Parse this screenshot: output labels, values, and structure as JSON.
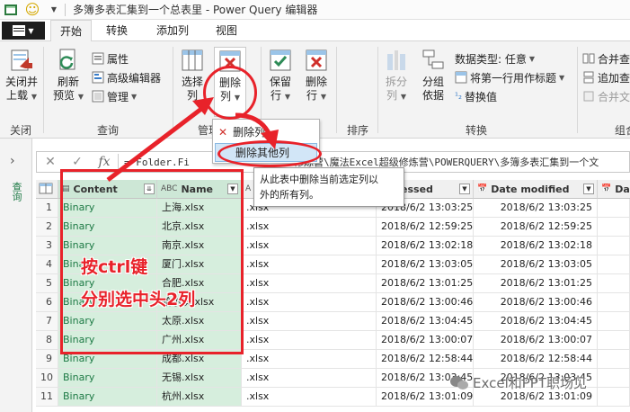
{
  "titlebar": {
    "title": "多簿多表汇集到一个总表里 - Power Query 编辑器",
    "smiley_glyph": "☺"
  },
  "ribbon_tabs": [
    "开始",
    "转换",
    "添加列",
    "视图"
  ],
  "ribbon": {
    "close_load": [
      "关闭并",
      "上载"
    ],
    "refresh_preview": [
      "刷新",
      "预览"
    ],
    "properties": "属性",
    "advanced_editor": "高级编辑器",
    "manage": "管理",
    "choose_columns": [
      "选择",
      "列"
    ],
    "remove_columns": [
      "删除",
      "列"
    ],
    "keep_rows": [
      "保留",
      "行"
    ],
    "remove_rows": [
      "删除",
      "行"
    ],
    "split_column": [
      "拆分",
      "列"
    ],
    "group_by": [
      "分组",
      "依据"
    ],
    "data_type": "数据类型: 任意",
    "first_row_headers": "将第一行用作标题",
    "replace_values": "替换值",
    "merge": "合并查",
    "append": "追加查",
    "combine": "合并文",
    "groups": {
      "close": "关闭",
      "query": "查询",
      "manage": "管理",
      "sort": "排序",
      "transform": "转换",
      "combine": "组合"
    }
  },
  "menu": {
    "remove_columns": "删除列",
    "remove_other_columns": "删除其他列"
  },
  "tooltip": {
    "line1": "从此表中删除当前选定列以",
    "line2": "外的所有列。"
  },
  "formula_bar": {
    "cancel": "✕",
    "confirm": "✓",
    "fx": "fx",
    "text": "= Folder.Fi",
    "text_tail": "修炼营\\魔法Excel超级修炼营\\POWERQUERY\\多簿多表汇集到一个文"
  },
  "left_pane": {
    "queries_label": "查询",
    "collapse_glyph": "›"
  },
  "grid": {
    "headers": {
      "content": "Content",
      "name": "Name",
      "accessed": "ccessed",
      "modified": "Date modified",
      "da": "Da"
    },
    "rows": [
      {
        "n": "1",
        "content": "Binary",
        "name": "上海.xlsx",
        "ext": ".xlsx",
        "accessed": "2018/6/2 13:03:25",
        "modified": "2018/6/2 13:03:25"
      },
      {
        "n": "2",
        "content": "Binary",
        "name": "北京.xlsx",
        "ext": ".xlsx",
        "accessed": "2018/6/2 12:59:25",
        "modified": "2018/6/2 12:59:25"
      },
      {
        "n": "3",
        "content": "Binary",
        "name": "南京.xlsx",
        "ext": ".xlsx",
        "accessed": "2018/6/2 13:02:18",
        "modified": "2018/6/2 13:02:18"
      },
      {
        "n": "4",
        "content": "Binary",
        "name": "厦门.xlsx",
        "ext": ".xlsx",
        "accessed": "2018/6/2 13:03:05",
        "modified": "2018/6/2 13:03:05"
      },
      {
        "n": "5",
        "content": "Binary",
        "name": "合肥.xlsx",
        "ext": ".xlsx",
        "accessed": "2018/6/2 13:01:25",
        "modified": "2018/6/2 13:01:25"
      },
      {
        "n": "6",
        "content": "Binary",
        "name": "哈尔滨.xlsx",
        "ext": ".xlsx",
        "accessed": "2018/6/2 13:00:46",
        "modified": "2018/6/2 13:00:46"
      },
      {
        "n": "7",
        "content": "Binary",
        "name": "太原.xlsx",
        "ext": ".xlsx",
        "accessed": "2018/6/2 13:04:45",
        "modified": "2018/6/2 13:04:45"
      },
      {
        "n": "8",
        "content": "Binary",
        "name": "广州.xlsx",
        "ext": ".xlsx",
        "accessed": "2018/6/2 13:00:07",
        "modified": "2018/6/2 13:00:07"
      },
      {
        "n": "9",
        "content": "Binary",
        "name": "成都.xlsx",
        "ext": ".xlsx",
        "accessed": "2018/6/2 12:58:44",
        "modified": "2018/6/2 12:58:44"
      },
      {
        "n": "10",
        "content": "Binary",
        "name": "无锡.xlsx",
        "ext": ".xlsx",
        "accessed": "2018/6/2 13:03:45",
        "modified": "2018/6/2 13:03:45"
      },
      {
        "n": "11",
        "content": "Binary",
        "name": "杭州.xlsx",
        "ext": ".xlsx",
        "accessed": "2018/6/2 13:01:09",
        "modified": "2018/6/2 13:01:09"
      }
    ]
  },
  "annotation": {
    "line1": "按ctrl键",
    "line2": "分别选中头2列"
  },
  "watermark": "Excel和PPT职场见",
  "colors": {
    "annotation_red": "#e8222a",
    "binary_green": "#1d7a45",
    "selected_column": "#d6eedd"
  }
}
